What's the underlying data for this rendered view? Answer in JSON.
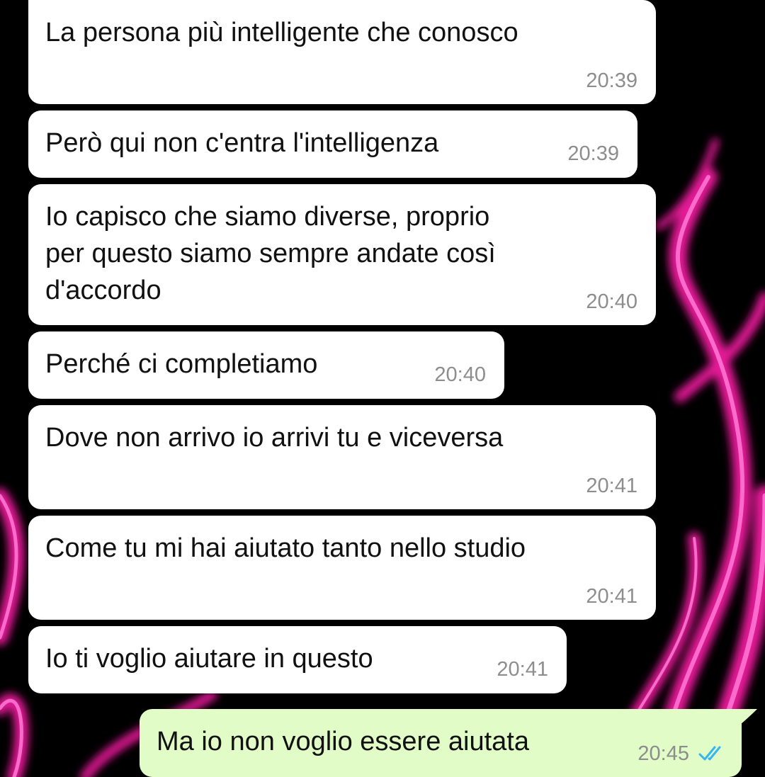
{
  "theme": {
    "incoming_bg": "#ffffff",
    "outgoing_bg": "#e2fcc8",
    "time_color": "#8d8d8d",
    "read_tick_color": "#34b7f1",
    "wallpaper_accent": "#ff1aa8"
  },
  "messages": [
    {
      "direction": "incoming",
      "text": "La persona più intelligente che conosco",
      "time": "20:39"
    },
    {
      "direction": "incoming",
      "text": "Però qui non c'entra l'intelligenza",
      "time": "20:39"
    },
    {
      "direction": "incoming",
      "text": "Io capisco che siamo diverse, proprio\nper questo siamo sempre andate così\nd'accordo",
      "time": "20:40"
    },
    {
      "direction": "incoming",
      "text": "Perché ci completiamo",
      "time": "20:40"
    },
    {
      "direction": "incoming",
      "text": "Dove non arrivo io arrivi tu e viceversa",
      "time": "20:41"
    },
    {
      "direction": "incoming",
      "text": "Come tu mi hai aiutato tanto nello studio",
      "time": "20:41"
    },
    {
      "direction": "incoming",
      "text": "Io ti voglio aiutare in questo",
      "time": "20:41"
    },
    {
      "direction": "outgoing",
      "text": "Ma io non voglio essere aiutata",
      "time": "20:45",
      "status_icon": "double-check-read-icon"
    }
  ]
}
